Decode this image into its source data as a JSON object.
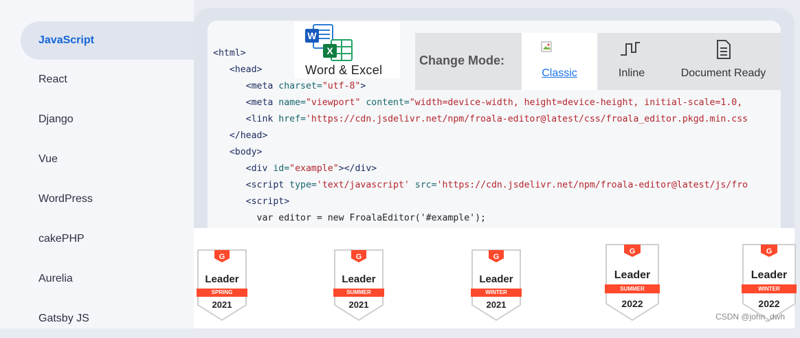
{
  "sidebar": {
    "items": [
      {
        "label": "JavaScript",
        "active": true
      },
      {
        "label": "React"
      },
      {
        "label": "Django"
      },
      {
        "label": "Vue"
      },
      {
        "label": "WordPress"
      },
      {
        "label": "cakePHP"
      },
      {
        "label": "Aurelia"
      },
      {
        "label": "Gatsby JS"
      }
    ]
  },
  "word_excel": {
    "label": "Word & Excel",
    "icons": [
      "word-icon",
      "excel-icon"
    ]
  },
  "mode_bar": {
    "title": "Change Mode:",
    "tabs": [
      {
        "label": "Classic",
        "icon": "broken-image-icon",
        "selected": true
      },
      {
        "label": "Inline",
        "icon": "inline-icon"
      },
      {
        "label": "Document Ready",
        "icon": "document-icon"
      }
    ]
  },
  "code": {
    "lines": [
      [
        {
          "t": "tag",
          "v": "<html>"
        }
      ],
      [
        {
          "t": "plain",
          "v": "   "
        },
        {
          "t": "tag",
          "v": "<head>"
        }
      ],
      [
        {
          "t": "plain",
          "v": "      "
        },
        {
          "t": "tag",
          "v": "<meta "
        },
        {
          "t": "attr",
          "v": "charset="
        },
        {
          "t": "str",
          "v": "\"utf-8\""
        },
        {
          "t": "tag",
          "v": ">"
        }
      ],
      [
        {
          "t": "plain",
          "v": "      "
        },
        {
          "t": "tag",
          "v": "<meta "
        },
        {
          "t": "attr",
          "v": "name="
        },
        {
          "t": "str",
          "v": "\"viewport\""
        },
        {
          "t": "attr",
          "v": " content="
        },
        {
          "t": "str",
          "v": "\"width=device-width, height=device-height, initial-scale=1.0,"
        }
      ],
      [
        {
          "t": "plain",
          "v": "      "
        },
        {
          "t": "tag",
          "v": "<link "
        },
        {
          "t": "attr",
          "v": "href="
        },
        {
          "t": "str",
          "v": "'https://cdn.jsdelivr.net/npm/froala-editor@latest/css/froala_editor.pkgd.min.css"
        }
      ],
      [
        {
          "t": "plain",
          "v": "   "
        },
        {
          "t": "tag",
          "v": "</head>"
        }
      ],
      [
        {
          "t": "plain",
          "v": "   "
        },
        {
          "t": "tag",
          "v": "<body>"
        }
      ],
      [
        {
          "t": "plain",
          "v": "      "
        },
        {
          "t": "tag",
          "v": "<div "
        },
        {
          "t": "attr",
          "v": "id="
        },
        {
          "t": "str",
          "v": "\"example\""
        },
        {
          "t": "tag",
          "v": "></div>"
        }
      ],
      [
        {
          "t": "plain",
          "v": "      "
        },
        {
          "t": "tag",
          "v": "<script "
        },
        {
          "t": "attr",
          "v": "type="
        },
        {
          "t": "str",
          "v": "'text/javascript'"
        },
        {
          "t": "attr",
          "v": " src="
        },
        {
          "t": "str",
          "v": "'https://cdn.jsdelivr.net/npm/froala-editor@latest/js/fro"
        }
      ],
      [
        {
          "t": "plain",
          "v": "      "
        },
        {
          "t": "tag",
          "v": "<script>"
        }
      ],
      [
        {
          "t": "plain",
          "v": "        var editor = new FroalaEditor('#example');"
        }
      ]
    ]
  },
  "badges": [
    {
      "title": "Leader",
      "season": "SPRING",
      "year": "2021"
    },
    {
      "title": "Leader",
      "season": "SUMMER",
      "year": "2021"
    },
    {
      "title": "Leader",
      "season": "WINTER",
      "year": "2021"
    },
    {
      "title": "Leader",
      "season": "SUMMER",
      "year": "2022"
    },
    {
      "title": "Leader",
      "season": "WINTER",
      "year": "2022"
    }
  ],
  "badge_brand": "G",
  "colors": {
    "accent": "#1565d8",
    "g2_red": "#ff492c",
    "link": "#1a73e8"
  },
  "watermark": "CSDN @john_dwh"
}
